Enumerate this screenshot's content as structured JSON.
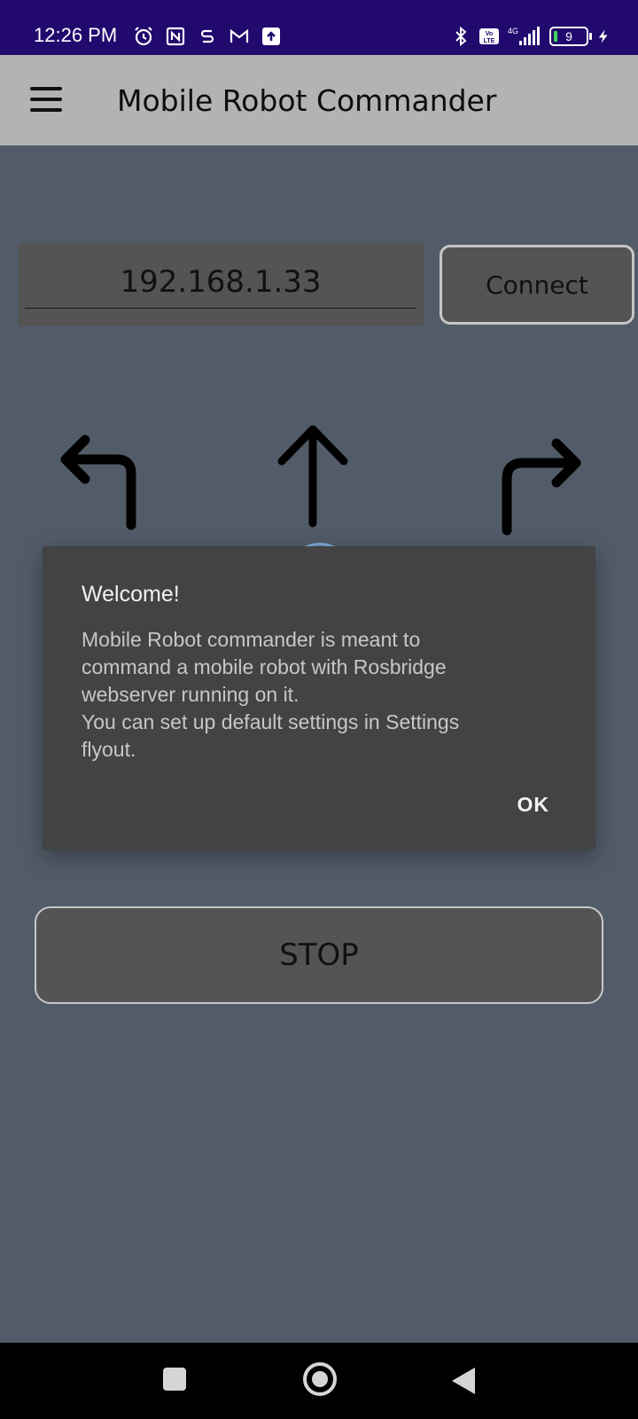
{
  "status_bar": {
    "time": "12:26 PM",
    "icons_left": [
      "alarm-icon",
      "nfc-icon",
      "s-app-icon",
      "gmail-icon",
      "upload-icon"
    ],
    "icons_right": [
      "bluetooth-icon",
      "volte-icon",
      "4g-signal-icon",
      "battery-icon"
    ],
    "network": "4G",
    "battery_level": "9"
  },
  "app_bar": {
    "title": "Mobile Robot Commander",
    "menu_icon": "hamburger-menu-icon"
  },
  "connection": {
    "ip_value": "192.168.1.33",
    "connect_label": "Connect"
  },
  "controls": {
    "left_icon": "turn-left-arrow-icon",
    "forward_icon": "up-arrow-icon",
    "right_icon": "turn-right-arrow-icon",
    "stop_label": "STOP"
  },
  "dialog": {
    "title": "Welcome!",
    "body_lines": [
      "Mobile Robot commander is meant to",
      "command a mobile robot with Rosbridge",
      "webserver running on it.",
      "You can set up default settings in Settings",
      "flyout."
    ],
    "ok_label": "OK"
  },
  "colors": {
    "status_bar": "#21096e",
    "app_bar": "#b3b3b3",
    "background": "#525c69",
    "dialog": "#434343"
  }
}
